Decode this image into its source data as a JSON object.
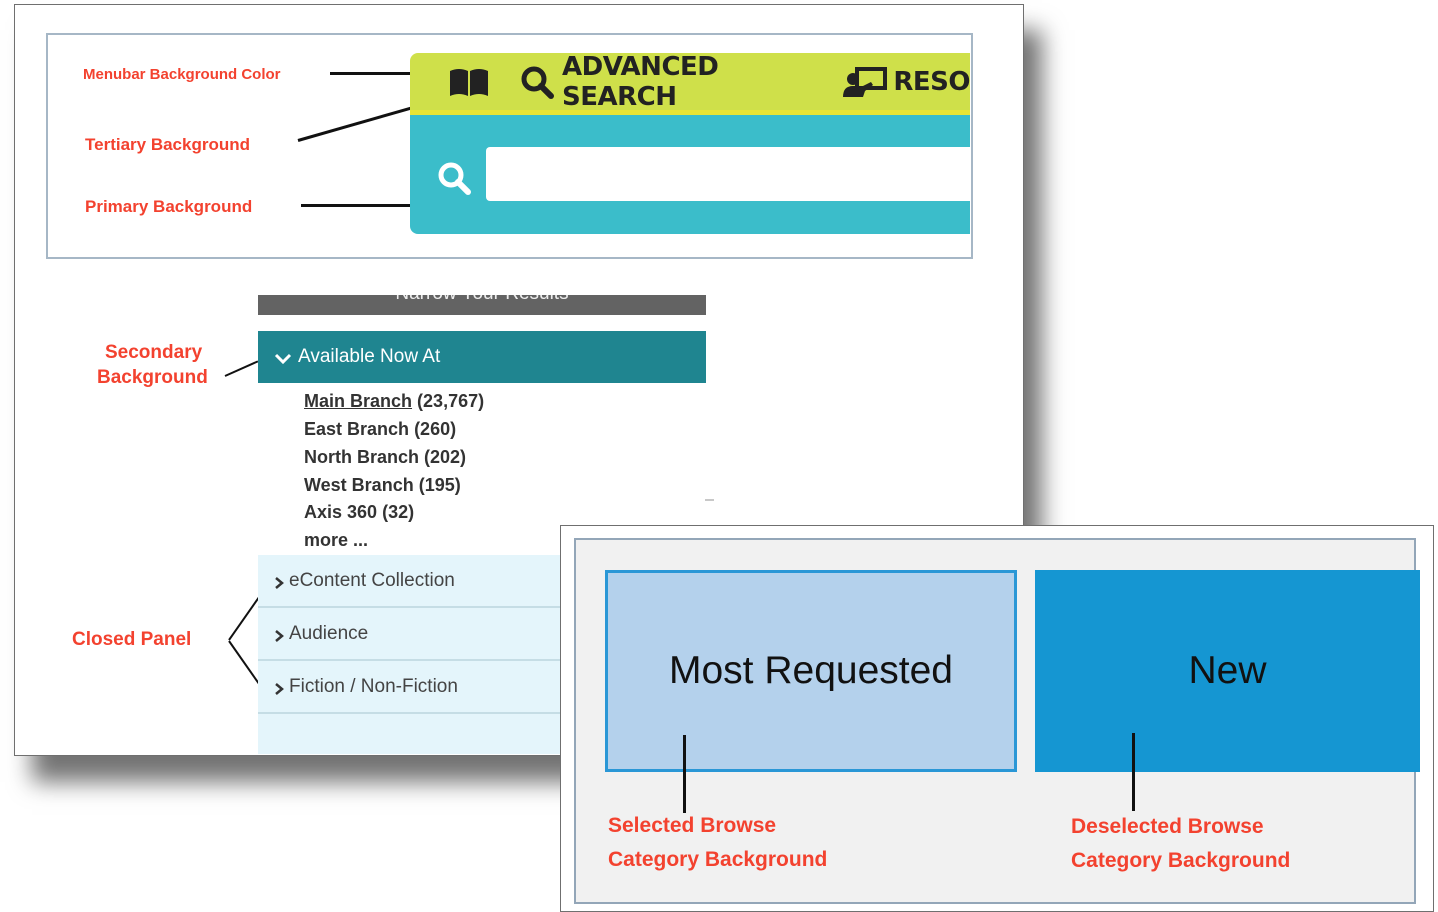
{
  "colors": {
    "annotation": "#f3422f",
    "menubar": "#cfe04a",
    "tertiary": "#e9e534",
    "primary": "#3bbdca",
    "secondary": "#1f8590",
    "closed_panel": "#e4f5fb",
    "selected_category": "#b4d1ec",
    "deselected_category": "#1596d2"
  },
  "annotations": {
    "menubar": "Menubar Background Color",
    "tertiary": "Tertiary Background",
    "primary": "Primary Background",
    "secondary_line1": "Secondary",
    "secondary_line2": "Background",
    "closed_panel": "Closed Panel",
    "selected_line1": "Selected Browse",
    "selected_line2": "Category Background",
    "deselected_line1": "Deselected Browse",
    "deselected_line2": "Category Background"
  },
  "menubar": {
    "icons": [
      "book-icon",
      "search-icon",
      "chalkboard-user-icon"
    ],
    "advanced_search": "ADVANCED SEARCH",
    "resources_partial": "RESO"
  },
  "search": {
    "icon": "search-icon",
    "value": ""
  },
  "facets": {
    "header_partial": "Narrow Your Results",
    "available_now": {
      "label": "Available Now At",
      "items": [
        {
          "name": "Main Branch",
          "count": "(23,767)"
        },
        {
          "name": "East Branch",
          "count": "(260)"
        },
        {
          "name": "North Branch",
          "count": "(202)"
        },
        {
          "name": "West Branch",
          "count": "(195)"
        },
        {
          "name": "Axis 360",
          "count": "(32)"
        }
      ],
      "more": "more ..."
    },
    "closed_panels": [
      "eContent Collection",
      "Audience",
      "Fiction / Non-Fiction"
    ]
  },
  "browse_categories": {
    "selected": "Most Requested",
    "deselected": "New"
  }
}
